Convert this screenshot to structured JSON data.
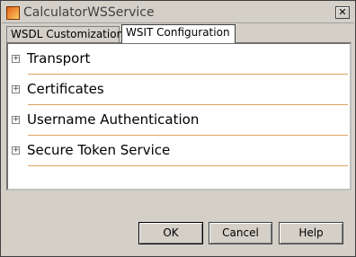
{
  "window": {
    "title": "CalculatorWSService"
  },
  "tabs": [
    {
      "label": "WSDL Customization",
      "active": false
    },
    {
      "label": "WSIT Configuration",
      "active": true
    }
  ],
  "sections": [
    {
      "label": "Transport",
      "expand_symbol": "+"
    },
    {
      "label": "Certificates",
      "expand_symbol": "+"
    },
    {
      "label": "Username Authentication",
      "expand_symbol": "+"
    },
    {
      "label": "Secure Token Service",
      "expand_symbol": "+"
    }
  ],
  "buttons": {
    "ok": "OK",
    "cancel": "Cancel",
    "help": "Help"
  },
  "colors": {
    "accent_rule": "#e0a060",
    "window_bg": "#d4d0c8"
  }
}
